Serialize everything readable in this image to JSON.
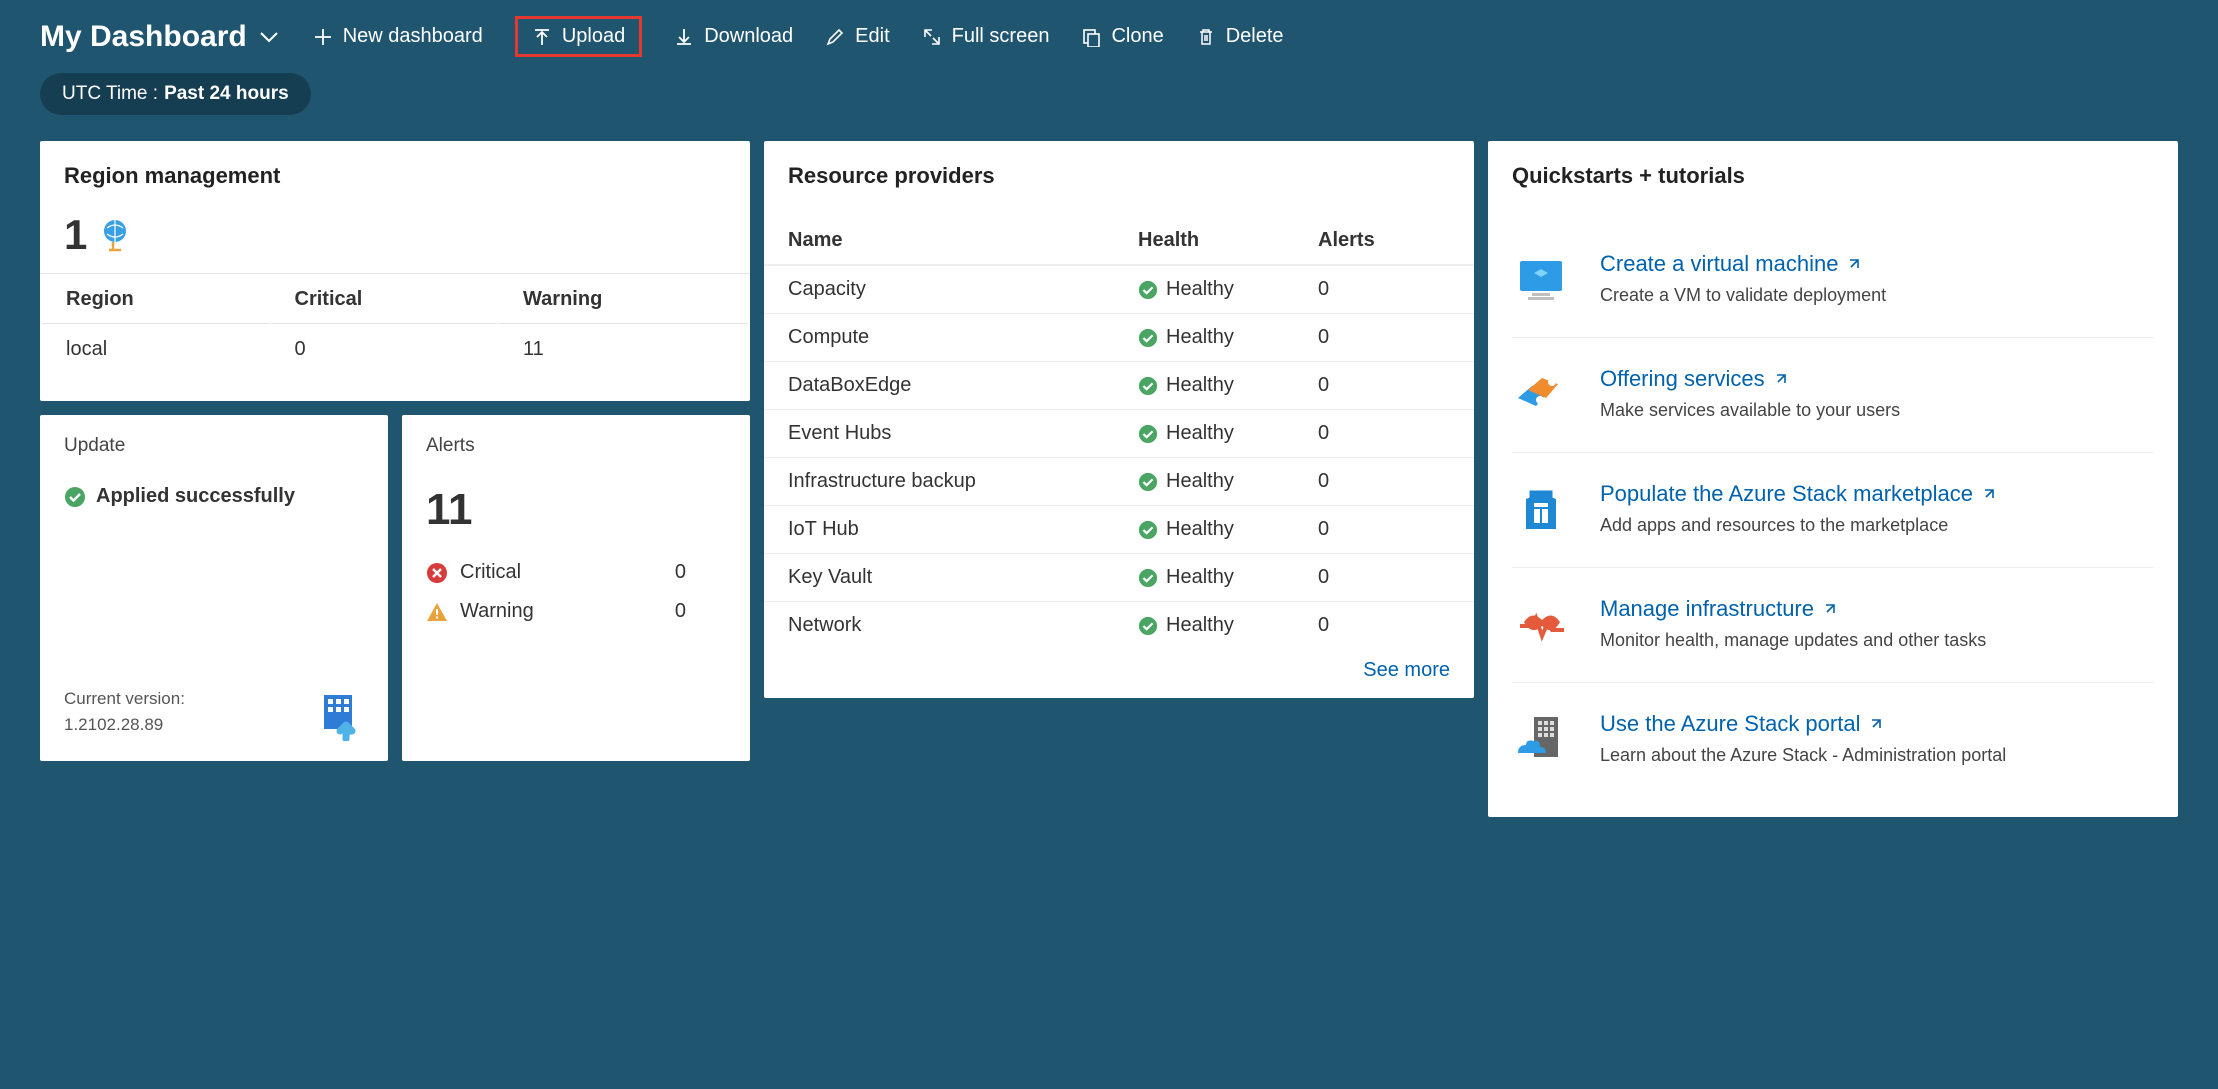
{
  "header": {
    "title": "My Dashboard",
    "new_dashboard": "New dashboard",
    "upload": "Upload",
    "download": "Download",
    "edit": "Edit",
    "full_screen": "Full screen",
    "clone": "Clone",
    "delete": "Delete"
  },
  "time_filter": {
    "prefix": "UTC Time :",
    "value": "Past 24 hours"
  },
  "region_mgmt": {
    "title": "Region management",
    "count": "1",
    "cols": {
      "region": "Region",
      "critical": "Critical",
      "warning": "Warning"
    },
    "row": {
      "region": "local",
      "critical": "0",
      "warning": "11"
    }
  },
  "update": {
    "title": "Update",
    "status": "Applied successfully",
    "version_label": "Current version:",
    "version": "1.2102.28.89"
  },
  "alerts_tile": {
    "title": "Alerts",
    "total": "11",
    "critical_label": "Critical",
    "critical_count": "0",
    "warning_label": "Warning",
    "warning_count": "0"
  },
  "resource_providers": {
    "title": "Resource providers",
    "cols": {
      "name": "Name",
      "health": "Health",
      "alerts": "Alerts"
    },
    "healthy": "Healthy",
    "rows": [
      {
        "name": "Capacity",
        "alerts": "0"
      },
      {
        "name": "Compute",
        "alerts": "0"
      },
      {
        "name": "DataBoxEdge",
        "alerts": "0"
      },
      {
        "name": "Event Hubs",
        "alerts": "0"
      },
      {
        "name": "Infrastructure backup",
        "alerts": "0"
      },
      {
        "name": "IoT Hub",
        "alerts": "0"
      },
      {
        "name": "Key Vault",
        "alerts": "0"
      },
      {
        "name": "Network",
        "alerts": "0"
      }
    ],
    "see_more": "See more"
  },
  "quickstarts": {
    "title": "Quickstarts + tutorials",
    "items": [
      {
        "title": "Create a virtual machine",
        "desc": "Create a VM to validate deployment"
      },
      {
        "title": "Offering services",
        "desc": "Make services available to your users"
      },
      {
        "title": "Populate the Azure Stack marketplace",
        "desc": "Add apps and resources to the marketplace"
      },
      {
        "title": "Manage infrastructure",
        "desc": "Monitor health, manage updates and other tasks"
      },
      {
        "title": "Use the Azure Stack portal",
        "desc": "Learn about the Azure Stack - Administration portal"
      }
    ]
  }
}
